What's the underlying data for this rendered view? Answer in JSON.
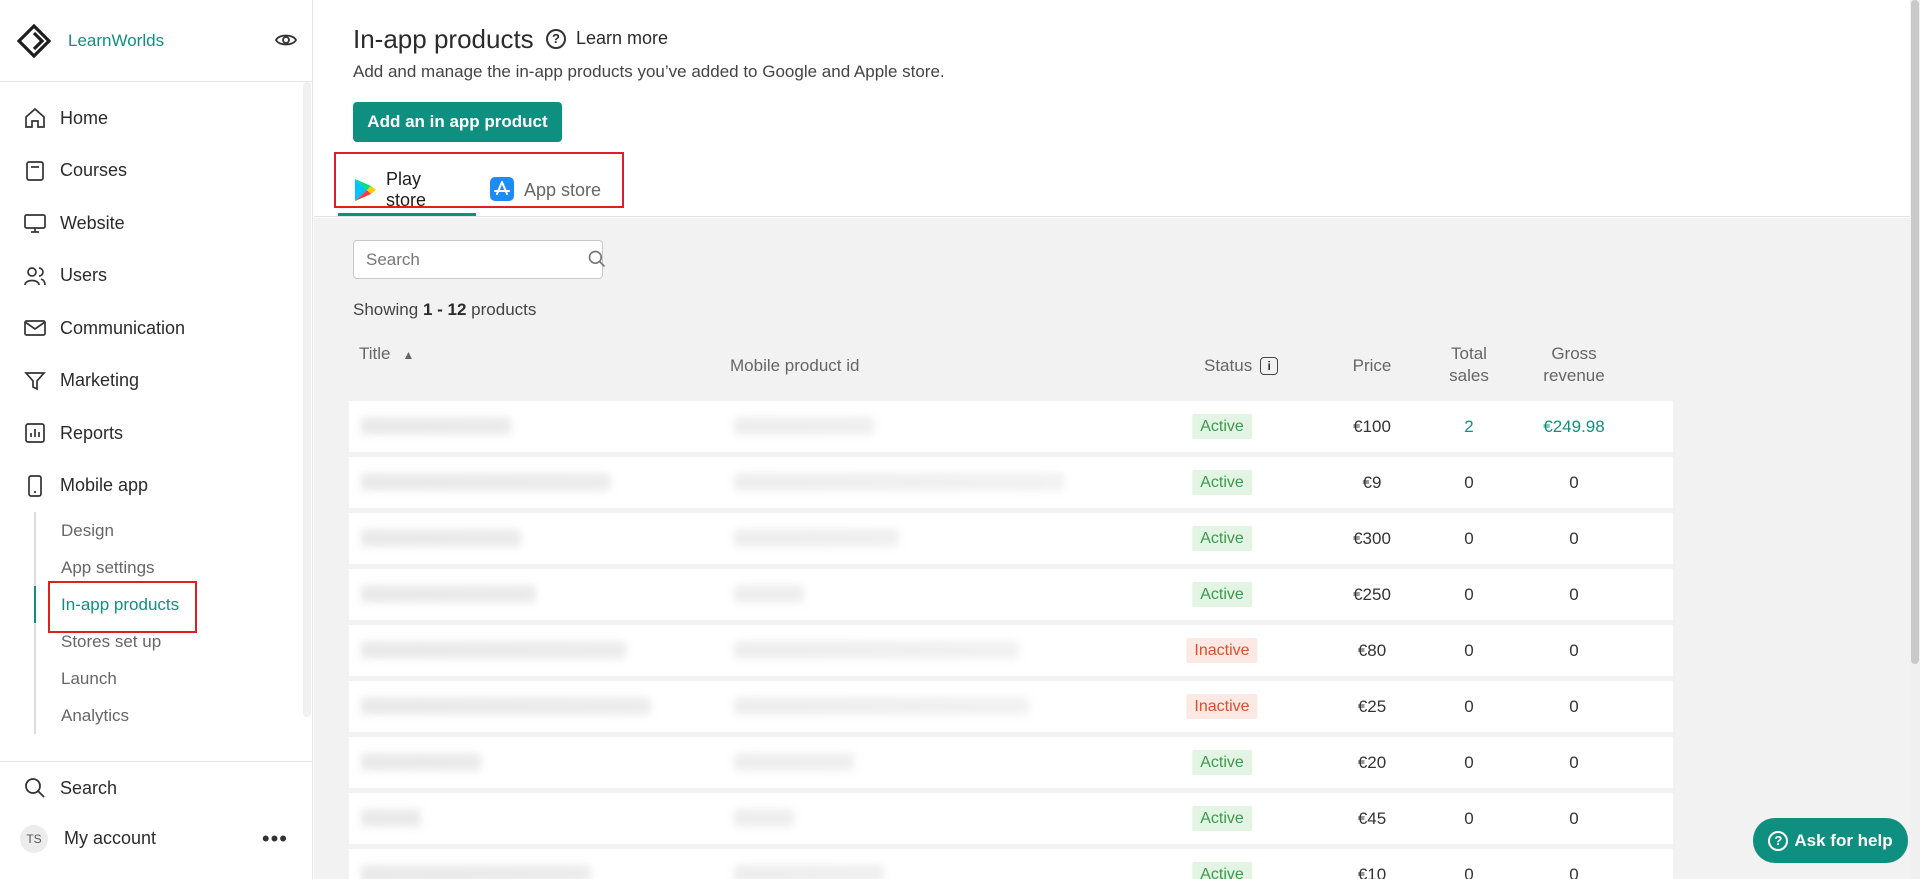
{
  "brand": {
    "name": "LearnWorlds"
  },
  "sidebar": {
    "items": [
      {
        "label": "Home",
        "icon": "home-icon"
      },
      {
        "label": "Courses",
        "icon": "book-icon"
      },
      {
        "label": "Website",
        "icon": "monitor-icon"
      },
      {
        "label": "Users",
        "icon": "users-icon"
      },
      {
        "label": "Communication",
        "icon": "mail-icon"
      },
      {
        "label": "Marketing",
        "icon": "funnel-icon"
      },
      {
        "label": "Reports",
        "icon": "chart-icon"
      },
      {
        "label": "Mobile app",
        "icon": "phone-icon"
      }
    ],
    "sub_items": [
      {
        "label": "Design"
      },
      {
        "label": "App settings"
      },
      {
        "label": "In-app products",
        "active": true
      },
      {
        "label": "Stores set up"
      },
      {
        "label": "Launch"
      },
      {
        "label": "Analytics"
      }
    ],
    "search_label": "Search",
    "account": {
      "initials": "TS",
      "label": "My account"
    }
  },
  "header": {
    "title": "In-app products",
    "learn_more": "Learn more",
    "subtitle": "Add and manage the in-app products you’ve added to Google and Apple store.",
    "add_button": "Add an in app product",
    "tabs": [
      {
        "label": "Play store",
        "active": true
      },
      {
        "label": "App store",
        "active": false
      }
    ]
  },
  "search": {
    "placeholder": "Search"
  },
  "showing": {
    "prefix": "Showing",
    "range": "1 - 12",
    "suffix": "products"
  },
  "table": {
    "columns": {
      "title": "Title",
      "mobile_id": "Mobile product id",
      "status": "Status",
      "price": "Price",
      "sales_line1": "Total",
      "sales_line2": "sales",
      "revenue_line1": "Gross",
      "revenue_line2": "revenue"
    },
    "rows": [
      {
        "status": "Active",
        "price": "€100",
        "sales": "2",
        "revenue": "€249.98"
      },
      {
        "status": "Active",
        "price": "€9",
        "sales": "0",
        "revenue": "0"
      },
      {
        "status": "Active",
        "price": "€300",
        "sales": "0",
        "revenue": "0"
      },
      {
        "status": "Active",
        "price": "€250",
        "sales": "0",
        "revenue": "0"
      },
      {
        "status": "Inactive",
        "price": "€80",
        "sales": "0",
        "revenue": "0"
      },
      {
        "status": "Inactive",
        "price": "€25",
        "sales": "0",
        "revenue": "0"
      },
      {
        "status": "Active",
        "price": "€20",
        "sales": "0",
        "revenue": "0"
      },
      {
        "status": "Active",
        "price": "€45",
        "sales": "0",
        "revenue": "0"
      },
      {
        "status": "Active",
        "price": "€10",
        "sales": "0",
        "revenue": "0"
      }
    ]
  },
  "help": {
    "label": "Ask for help"
  },
  "colors": {
    "accent": "#0f8f80",
    "active_bg": "#e3f4e5",
    "inactive_bg": "#fde9e3",
    "highlight": "#e02020"
  }
}
